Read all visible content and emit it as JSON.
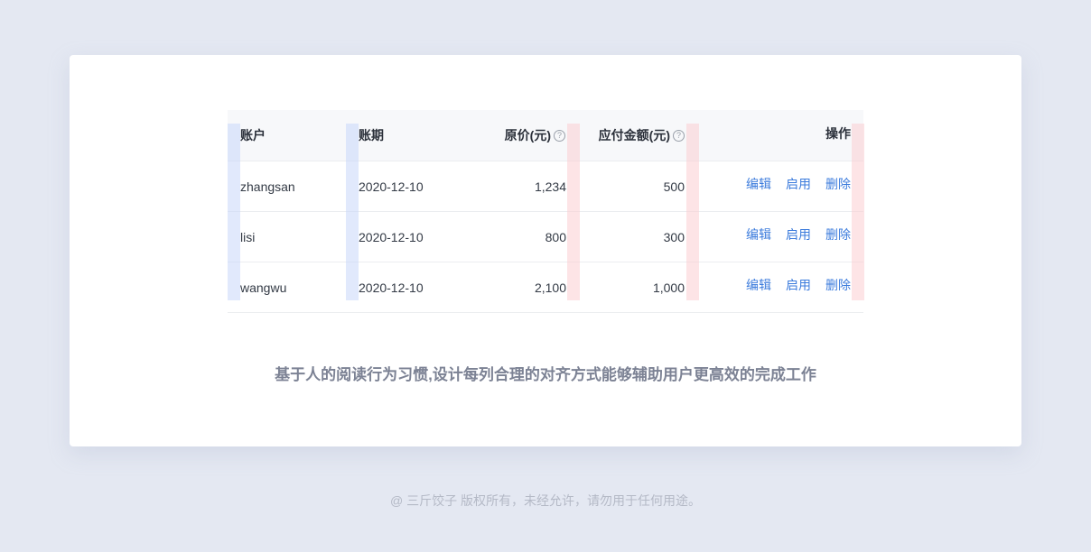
{
  "table": {
    "headers": {
      "account": "账户",
      "period": "账期",
      "price": "原价(元)",
      "payable": "应付金额(元)",
      "actions": "操作"
    },
    "help_icon": "question-circle-icon",
    "rows": [
      {
        "account": "zhangsan",
        "period": "2020-12-10",
        "price": "1,234",
        "payable": "500"
      },
      {
        "account": "lisi",
        "period": "2020-12-10",
        "price": "800",
        "payable": "300"
      },
      {
        "account": "wangwu",
        "period": "2020-12-10",
        "price": "2,100",
        "payable": "1,000"
      }
    ],
    "actions": {
      "edit": "编辑",
      "enable": "启用",
      "delete": "删除"
    }
  },
  "caption": "基于人的阅读行为习惯,设计每列合理的对齐方式能够辅助用户更高效的完成工作",
  "copyright": "@ 三斤饺子  版权所有，未经允许，请勿用于任何用途。",
  "colors": {
    "background": "#e4e8f2",
    "card": "#ffffff",
    "link": "#3b7bdc",
    "guide_left": "#c8d7fa",
    "guide_right": "#fccdd2"
  }
}
